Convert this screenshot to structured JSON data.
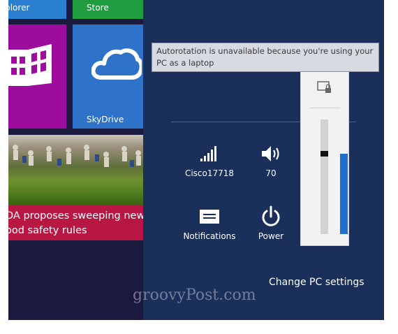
{
  "tiles": {
    "explorer_label": "xplorer",
    "store_label": "Store",
    "skydrive_label": "SkyDrive",
    "news_headline": "DA proposes sweeping new ood safety rules"
  },
  "quick_settings": {
    "network_label": "Cisco17718",
    "volume_label": "70",
    "notifications_label": "Notifications",
    "power_label": "Power"
  },
  "change_pc_settings": "Change PC settings",
  "tooltip": "Autorotation is unavailable because you're using your PC as a laptop",
  "brightness": {
    "level": 0.7
  },
  "watermark": "groovyPost.com",
  "colors": {
    "start_background": "#1a1a3e",
    "charms_background": "#1a2f5a",
    "explorer_tile": "#2a7fd0",
    "store_tile": "#1f9d3f",
    "purple_tile": "#9d0c9d",
    "skydrive_tile": "#2e73c9",
    "news_tile": "#b81643",
    "slider_fill": "#1e6fd0"
  }
}
